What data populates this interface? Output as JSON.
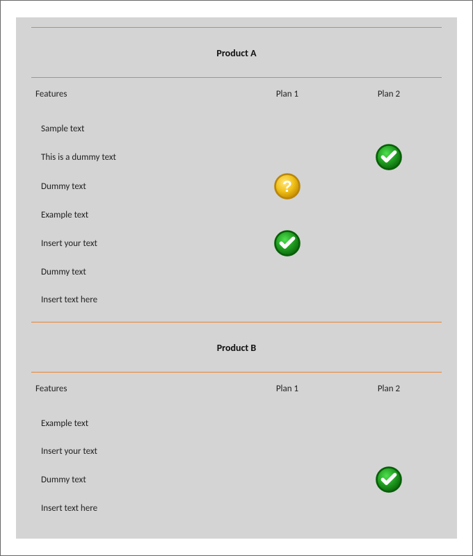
{
  "colors": {
    "rule": "#e9822c",
    "slab": "#d4d4d4",
    "check_fill": "#1f9b1f",
    "check_rim": "#075f07",
    "q_fill": "#f1c21b",
    "q_rim": "#b8860b"
  },
  "columns": {
    "features": "Features",
    "plan1": "Plan 1",
    "plan2": "Plan 2"
  },
  "products": [
    {
      "title": "Product A",
      "rows": [
        {
          "label": "Sample text",
          "plan1": "",
          "plan2": ""
        },
        {
          "label": "This is a dummy text",
          "plan1": "",
          "plan2": "check"
        },
        {
          "label": "Dummy text",
          "plan1": "question",
          "plan2": ""
        },
        {
          "label": "Example text",
          "plan1": "",
          "plan2": ""
        },
        {
          "label": "Insert your text",
          "plan1": "check",
          "plan2": ""
        },
        {
          "label": "Dummy text",
          "plan1": "",
          "plan2": ""
        },
        {
          "label": "Insert text here",
          "plan1": "",
          "plan2": ""
        }
      ]
    },
    {
      "title": "Product B",
      "rows": [
        {
          "label": "Example text",
          "plan1": "",
          "plan2": ""
        },
        {
          "label": "Insert your text",
          "plan1": "",
          "plan2": ""
        },
        {
          "label": "Dummy text",
          "plan1": "",
          "plan2": "check"
        },
        {
          "label": "Insert text here",
          "plan1": "",
          "plan2": ""
        }
      ]
    }
  ]
}
